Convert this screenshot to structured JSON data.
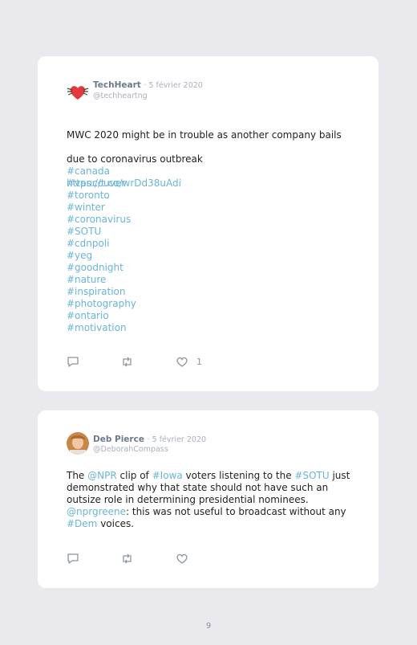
{
  "tweets": [
    {
      "name": "TechHeart",
      "date": "· 5 février 2020",
      "handle": "@techheartng",
      "text_line1": "MWC 2020 might be in trouble as another company bails",
      "text_line2": "due to coronavirus outbreak",
      "link": "https://t.co/wrDd38uAdi",
      "hashtags": [
        "#canada",
        "#vancouver",
        "#toronto",
        "#winter",
        "#coronavirus",
        "#SOTU",
        "#cdnpoli",
        "#yeg",
        "#goodnight",
        "#nature",
        "#inspiration",
        "#photography",
        "#ontario",
        "#motivation"
      ],
      "likes": "1",
      "avatar_icon": "heart-logo-icon"
    },
    {
      "name": "Deb Pierce",
      "date": "· 5 février 2020",
      "handle": "@DeborahCompass",
      "segments": {
        "s1": "The ",
        "s2": "@NPR",
        "s3": " clip of ",
        "s4": "#Iowa",
        "s5": " voters listening to the ",
        "s6": "#SOTU",
        "s7": " just\ndemonstrated why that state should not have such an\noutsize role in determining presidential nominees.\n",
        "s8": "@nprgreene",
        "s9": ": this was not useful to broadcast without any\n",
        "s10": "#Dem",
        "s11": " voices."
      },
      "avatar_icon": "profile-photo"
    }
  ],
  "page_number": "9",
  "colors": {
    "link": "#6ab4d8",
    "icon": "#8a94a0",
    "background": "#e9e9ee"
  }
}
